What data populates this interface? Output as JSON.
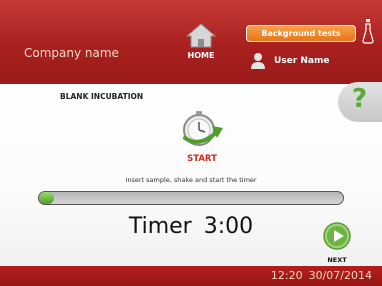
{
  "header": {
    "company_name": "Company name",
    "home_label": "HOME",
    "background_tests_label": "Background tests",
    "user_name": "User Name"
  },
  "main": {
    "title": "BLANK INCUBATION",
    "help_symbol": "?",
    "start_label": "START",
    "instruction": "Insert sample, shake and start the timer",
    "progress_fraction": 0.05,
    "timer_label": "Timer",
    "timer_value": "3:00",
    "next_label": "NEXT"
  },
  "footer": {
    "time": "12:20",
    "date": "30/07/2014"
  },
  "colors": {
    "header_red": "#a8211f",
    "accent_orange": "#e9741a",
    "accent_green": "#58a83a",
    "start_red": "#d12a1a"
  },
  "icons": {
    "home": "house-icon",
    "user": "user-icon",
    "flask": "flask-icon",
    "help": "question-mark-icon",
    "start": "stopwatch-arrow-icon",
    "next": "play-arrow-icon"
  }
}
